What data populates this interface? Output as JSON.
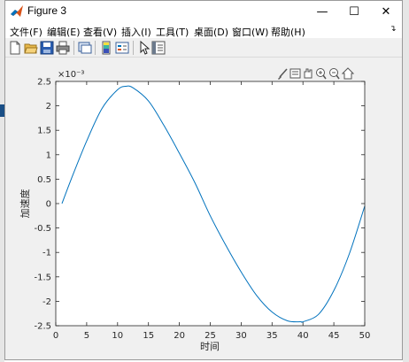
{
  "window": {
    "title": "Figure 3",
    "controls": {
      "minimize": "—",
      "maximize": "☐",
      "close": "✕"
    }
  },
  "menu": [
    {
      "label": "文件(F)"
    },
    {
      "label": "编辑(E)"
    },
    {
      "label": "查看(V)"
    },
    {
      "label": "插入(I)"
    },
    {
      "label": "工具(T)"
    },
    {
      "label": "桌面(D)"
    },
    {
      "label": "窗口(W)"
    },
    {
      "label": "帮助(H)"
    }
  ],
  "toolbar": {
    "icons": [
      "new-figure-icon",
      "open-file-icon",
      "save-icon",
      "print-icon",
      "link-plot-icon",
      "insert-colorbar-icon",
      "insert-legend-icon",
      "edit-plot-icon",
      "property-inspector-icon"
    ]
  },
  "axes_toolbar": {
    "icons": [
      "brush-icon",
      "data-tips-icon",
      "pan-icon",
      "zoom-in-icon",
      "zoom-out-icon",
      "home-icon"
    ]
  },
  "colors": {
    "line": "#0072bd",
    "axes_bg": "#ffffff",
    "figure_bg": "#f0f0f0"
  },
  "chart_data": {
    "type": "line",
    "title": "",
    "xlabel": "时间",
    "ylabel": "加速度",
    "exponent_label": "×10⁻³",
    "xlim": [
      0,
      50
    ],
    "ylim": [
      -2.5,
      2.5
    ],
    "xticks": [
      "0",
      "5",
      "10",
      "15",
      "20",
      "25",
      "30",
      "35",
      "40",
      "45",
      "50"
    ],
    "yticks": [
      "2.5",
      "2",
      "1.5",
      "1",
      "0.5",
      "0",
      "-0.5",
      "-1",
      "-1.5",
      "-2",
      "-2.5"
    ],
    "grid": false,
    "series": [
      {
        "x": [
          1,
          2.5,
          5,
          7.5,
          10,
          11.3,
          12.5,
          15,
          17.5,
          20,
          22.5,
          25,
          27.5,
          30,
          32.5,
          35,
          37.5,
          39.7,
          40,
          42.5,
          45,
          47.5,
          50
        ],
        "values": [
          0,
          0.5,
          1.28,
          1.95,
          2.33,
          2.4,
          2.37,
          2.1,
          1.6,
          1.03,
          0.43,
          -0.25,
          -0.85,
          -1.4,
          -1.88,
          -2.22,
          -2.4,
          -2.42,
          -2.42,
          -2.27,
          -1.78,
          -1.03,
          -0.05
        ]
      }
    ]
  }
}
